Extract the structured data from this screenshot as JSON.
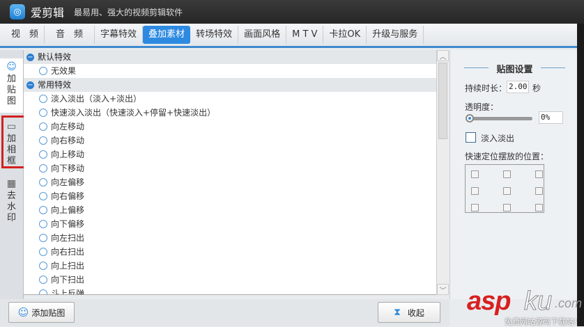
{
  "app": {
    "name": "爱剪辑",
    "slogan": "最易用、强大的视频剪辑软件"
  },
  "tabs": [
    {
      "label": "视　频"
    },
    {
      "label": "音　频"
    },
    {
      "label": "字幕特效"
    },
    {
      "label": "叠加素材",
      "active": true
    },
    {
      "label": "转场特效"
    },
    {
      "label": "画面风格"
    },
    {
      "label": "M T V"
    },
    {
      "label": "卡拉OK"
    },
    {
      "label": "升级与服务"
    }
  ],
  "side_tabs": [
    {
      "label": "加贴图",
      "icon": "smiley-plus-icon"
    },
    {
      "label": "加相框",
      "icon": "frame-plus-icon"
    },
    {
      "label": "去水印",
      "icon": "mosaic-icon"
    }
  ],
  "groups": [
    {
      "title": "默认特效",
      "items": [
        "无效果"
      ]
    },
    {
      "title": "常用特效",
      "items": [
        "淡入淡出（淡入+淡出）",
        "快速淡入淡出（快速淡入+停留+快速淡出）",
        "向左移动",
        "向右移动",
        "向上移动",
        "向下移动",
        "向左偏移",
        "向右偏移",
        "向上偏移",
        "向下偏移",
        "向左扫出",
        "向右扫出",
        "向上扫出",
        "向下扫出",
        "斗上反弹"
      ]
    }
  ],
  "settings": {
    "title": "贴图设置",
    "duration_label": "持续时长：",
    "duration_value": "2.00",
    "duration_unit": "秒",
    "opacity_label": "透明度：",
    "opacity_value": "0%",
    "opacity": 0,
    "fade_label": "淡入淡出",
    "fade_checked": false,
    "position_label": "快速定位摆放的位置："
  },
  "buttons": {
    "add_sticker": "添加贴图",
    "collapse": "收起"
  },
  "watermark": {
    "brand": "asp",
    "brand2": "ku",
    "domain": ".com",
    "tagline": "免费网站源码下载站!"
  },
  "colors": {
    "accent": "#2d8ae0",
    "highlight": "#d42020"
  }
}
